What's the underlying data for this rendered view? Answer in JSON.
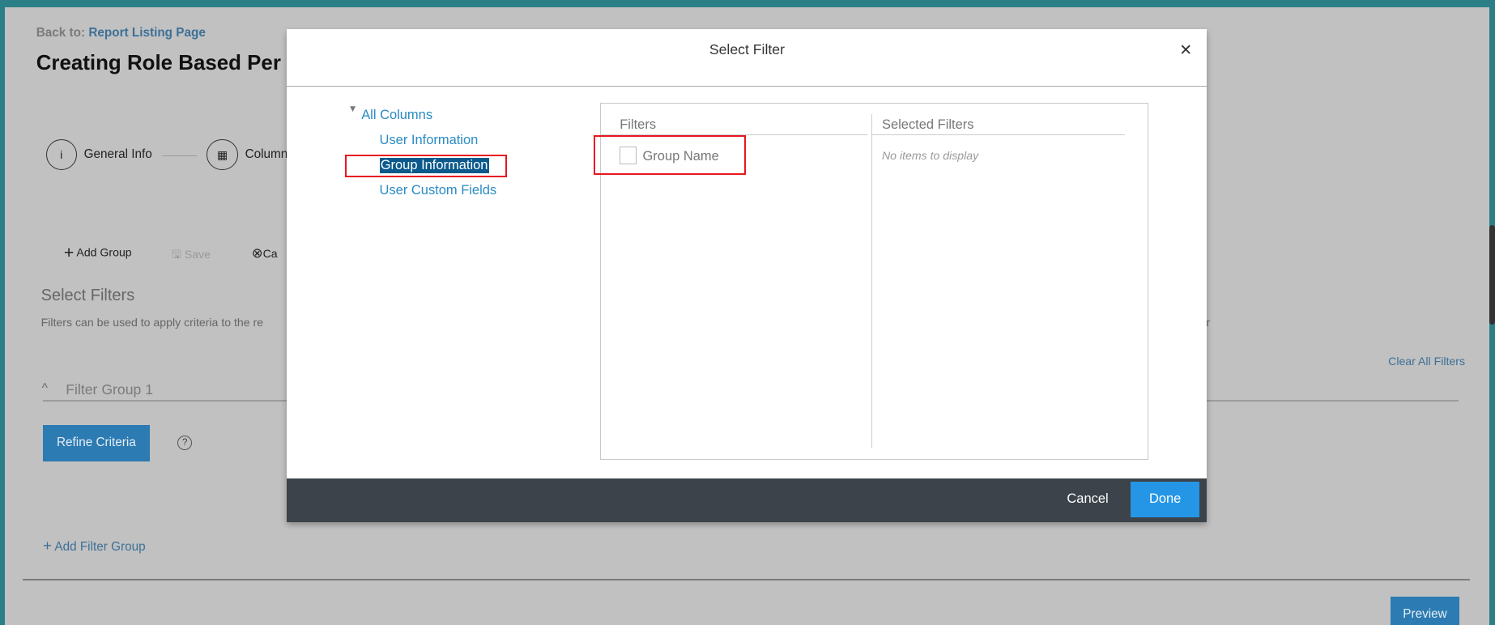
{
  "page": {
    "back_prefix": "Back to:",
    "back_link": "Report Listing Page",
    "title": "Creating Role Based Per",
    "steps": [
      {
        "label": "General Info",
        "icon": "info-icon"
      },
      {
        "label": "Column",
        "icon": "grid-icon"
      }
    ],
    "toolbar": {
      "add_group": "Add Group",
      "save": "Save",
      "cancel": "Ca"
    },
    "section_title": "Select Filters",
    "section_desc": "Filters can be used to apply criteria to the re",
    "section_desc_tail": "r",
    "clear_all": "Clear All Filters",
    "filter_group": "Filter Group 1",
    "refine_criteria": "Refine Criteria",
    "help": "?",
    "add_filter_group": "Add Filter Group",
    "preview": "Preview"
  },
  "modal": {
    "title": "Select Filter",
    "close": "✕",
    "tree": {
      "root": "All Columns",
      "items": [
        "User Information",
        "Group Information",
        "User Custom Fields"
      ],
      "selected": "Group Information"
    },
    "filters_header": "Filters",
    "filters": [
      {
        "label": "Group Name",
        "checked": false
      }
    ],
    "selected_header": "Selected Filters",
    "empty_text": "No items to display",
    "cancel": "Cancel",
    "done": "Done"
  },
  "colors": {
    "highlight": "#e8161f",
    "done": "#2596e6",
    "footer": "#3c434a",
    "link": "#2a8bc4"
  }
}
